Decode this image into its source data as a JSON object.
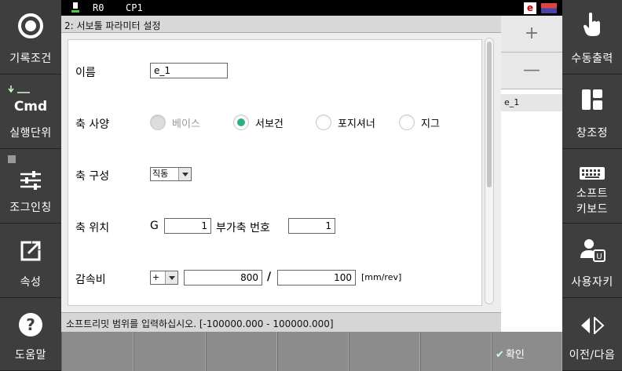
{
  "topbar": {
    "robot_label": "R0",
    "program_label": "CP1",
    "e_badge": "e"
  },
  "left_menu": [
    {
      "label": "기록조건",
      "icon": "record-circle-icon"
    },
    {
      "label": "실행단위",
      "cmd": "Cmd",
      "icon": "cmd-step-icon"
    },
    {
      "label": "조그인칭",
      "icon": "sliders-icon"
    },
    {
      "label": "속성",
      "icon": "edit-external-icon"
    },
    {
      "label": "도움말",
      "icon": "help-icon"
    }
  ],
  "right_menu": [
    {
      "label": "수동출력",
      "icon": "hand-pointer-icon"
    },
    {
      "label": "창조정",
      "icon": "window-layout-icon"
    },
    {
      "label_line1": "소프트",
      "label_line2": "키보드",
      "icon": "keyboard-icon"
    },
    {
      "label": "사용자키",
      "icon": "user-key-icon"
    },
    {
      "label": "이전/다음",
      "icon": "prev-next-icon"
    }
  ],
  "dialog": {
    "title": "2: 서보툴 파라미터 설정",
    "name_label": "이름",
    "name_value": "e_1",
    "axis_spec_label": "축 사양",
    "axis_spec_options": [
      {
        "label": "베이스",
        "selected": false,
        "disabled": true
      },
      {
        "label": "서보건",
        "selected": true,
        "disabled": false
      },
      {
        "label": "포지셔너",
        "selected": false,
        "disabled": false
      },
      {
        "label": "지그",
        "selected": false,
        "disabled": false
      }
    ],
    "axis_config_label": "축 구성",
    "axis_config_value": "직동",
    "axis_pos_label": "축 위치",
    "g_label": "G",
    "g_value": "1",
    "aux_axis_label": "부가축 번호",
    "aux_axis_value": "1",
    "reduction_label": "감속비",
    "reduction_sign": "+",
    "reduction_num": "800",
    "reduction_slash": "/",
    "reduction_den": "100",
    "reduction_unit": "[mm/rev]"
  },
  "status_text": "소프트리밋 범위를 입력하십시오. [-100000.000 - 100000.000]",
  "list_panel": {
    "plus": "+",
    "minus": "—",
    "items": [
      "e_1"
    ]
  },
  "bottom_bar": {
    "confirm_label": "확인"
  },
  "colors": {
    "accent": "#2db08a",
    "side_bg": "#3e3e3e",
    "bottom_bg": "#8c8c8c"
  }
}
